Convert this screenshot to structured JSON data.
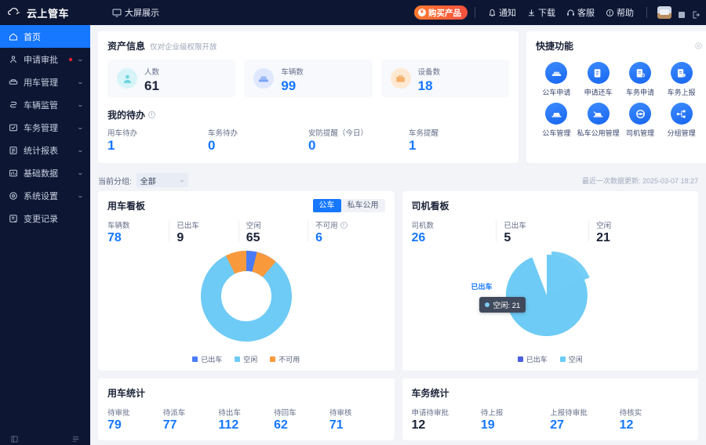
{
  "header": {
    "brand": "云上管车",
    "bigscreen": "大屏展示",
    "bigscreen_icon": "monitor-icon",
    "buy_label": "购买产品",
    "buy_icon": "coin-icon",
    "items": [
      {
        "label": "通知",
        "icon": "bell-icon"
      },
      {
        "label": "下载",
        "icon": "download-icon"
      },
      {
        "label": "客服",
        "icon": "headset-icon"
      },
      {
        "label": "帮助",
        "icon": "question-circle-icon"
      }
    ],
    "avatar": "user-avatar",
    "mini_icons": [
      "grid-icon",
      "logout-icon"
    ]
  },
  "sidebar": {
    "items": [
      {
        "label": "首页",
        "icon": "home-icon",
        "active": true,
        "expandable": false,
        "badge": false
      },
      {
        "label": "申请审批",
        "icon": "approval-icon",
        "active": false,
        "expandable": true,
        "badge": true
      },
      {
        "label": "用车管理",
        "icon": "car-manage-icon",
        "active": false,
        "expandable": true,
        "badge": false
      },
      {
        "label": "车辆监管",
        "icon": "monitor-car-icon",
        "active": false,
        "expandable": true,
        "badge": false
      },
      {
        "label": "车务管理",
        "icon": "service-icon",
        "active": false,
        "expandable": true,
        "badge": false
      },
      {
        "label": "统计报表",
        "icon": "report-icon",
        "active": false,
        "expandable": true,
        "badge": false
      },
      {
        "label": "基础数据",
        "icon": "database-icon",
        "active": false,
        "expandable": true,
        "badge": false
      },
      {
        "label": "系统设置",
        "icon": "settings-icon",
        "active": false,
        "expandable": true,
        "badge": false
      },
      {
        "label": "变更记录",
        "icon": "history-icon",
        "active": false,
        "expandable": false,
        "badge": false
      }
    ],
    "bottom_icons": [
      "collapse-icon",
      "list-icon"
    ]
  },
  "asset": {
    "title": "资产信息",
    "subtitle": "仅对企业级权限开放",
    "tiles": [
      {
        "label": "人数",
        "value": "61",
        "icon": "person-icon",
        "blue": false
      },
      {
        "label": "车辆数",
        "value": "99",
        "icon": "car-icon",
        "blue": true
      },
      {
        "label": "设备数",
        "value": "18",
        "icon": "device-icon",
        "blue": true
      }
    ],
    "todo_title": "我的待办",
    "todos": [
      {
        "label": "用车待办",
        "value": "1"
      },
      {
        "label": "车务待办",
        "value": "0"
      },
      {
        "label": "安防提醒（今日）",
        "value": "0"
      },
      {
        "label": "车务提醒",
        "value": "1"
      }
    ]
  },
  "quick": {
    "title": "快捷功能",
    "gear_icon": "gear-icon",
    "items": [
      {
        "label": "公车申请",
        "icon": "car-apply-icon"
      },
      {
        "label": "申请还车",
        "icon": "return-car-icon"
      },
      {
        "label": "车务申请",
        "icon": "service-apply-icon"
      },
      {
        "label": "车务上报",
        "icon": "service-report-icon"
      },
      {
        "label": "公车管理",
        "icon": "public-car-icon"
      },
      {
        "label": "私车公用管理",
        "icon": "private-car-icon"
      },
      {
        "label": "司机管理",
        "icon": "driver-icon"
      },
      {
        "label": "分组管理",
        "icon": "group-icon"
      }
    ]
  },
  "filter": {
    "label": "当前分组:",
    "selected": "全部",
    "options": [
      "全部"
    ],
    "update_text": "最近一次数据更新: 2025-03-07 18:27"
  },
  "vehicle_board": {
    "title": "用车看板",
    "tabs": [
      {
        "label": "公车",
        "active": true
      },
      {
        "label": "私车公用",
        "active": false
      }
    ],
    "kpis": [
      {
        "label": "车辆数",
        "value": "78",
        "blue": true,
        "info": false
      },
      {
        "label": "已出车",
        "value": "9",
        "blue": false,
        "info": false
      },
      {
        "label": "空闲",
        "value": "65",
        "blue": false,
        "info": false
      },
      {
        "label": "不可用",
        "value": "6",
        "blue": true,
        "info": true
      }
    ]
  },
  "driver_board": {
    "title": "司机看板",
    "kpis": [
      {
        "label": "司机数",
        "value": "26",
        "blue": true,
        "info": false
      },
      {
        "label": "已出车",
        "value": "5",
        "blue": false,
        "info": false
      },
      {
        "label": "空闲",
        "value": "21",
        "blue": false,
        "info": false
      }
    ],
    "slice_label": "已出车",
    "pie_label": "空闲",
    "tooltip": "空闲: 21"
  },
  "vehicle_stats": {
    "title": "用车统计",
    "cells": [
      {
        "label": "待审批",
        "value": "79",
        "blue": true
      },
      {
        "label": "待派车",
        "value": "77",
        "blue": true
      },
      {
        "label": "待出车",
        "value": "112",
        "blue": true
      },
      {
        "label": "待回车",
        "value": "62",
        "blue": true
      },
      {
        "label": "待审核",
        "value": "71",
        "blue": true
      }
    ]
  },
  "service_stats": {
    "title": "车务统计",
    "cells": [
      {
        "label": "申请待审批",
        "value": "12",
        "blue": false
      },
      {
        "label": "待上报",
        "value": "19",
        "blue": true
      },
      {
        "label": "上报待审批",
        "value": "27",
        "blue": true
      },
      {
        "label": "待核实",
        "value": "12",
        "blue": true
      }
    ]
  },
  "colors": {
    "brand_navy": "#0d1733",
    "accent_blue": "#1677ff",
    "orange": "#f4632f",
    "chart_dispatched": "#4a7bf7",
    "chart_idle": "#6ecbf5",
    "chart_unavailable": "#f89a3c"
  },
  "chart_data": [
    {
      "type": "pie",
      "title": "用车看板",
      "labels": [
        "已出车",
        "空闲",
        "不可用"
      ],
      "values": [
        9,
        65,
        6
      ],
      "colors": [
        "#4a7bf7",
        "#6ecbf5",
        "#f89a3c"
      ],
      "donut": true,
      "legend_position": "bottom"
    },
    {
      "type": "pie",
      "title": "司机看板",
      "labels": [
        "已出车",
        "空闲"
      ],
      "values": [
        5,
        21
      ],
      "colors": [
        "#4a7bf7",
        "#6ecbf5"
      ],
      "donut": false,
      "legend_position": "bottom",
      "annotation": "空闲: 21"
    }
  ]
}
